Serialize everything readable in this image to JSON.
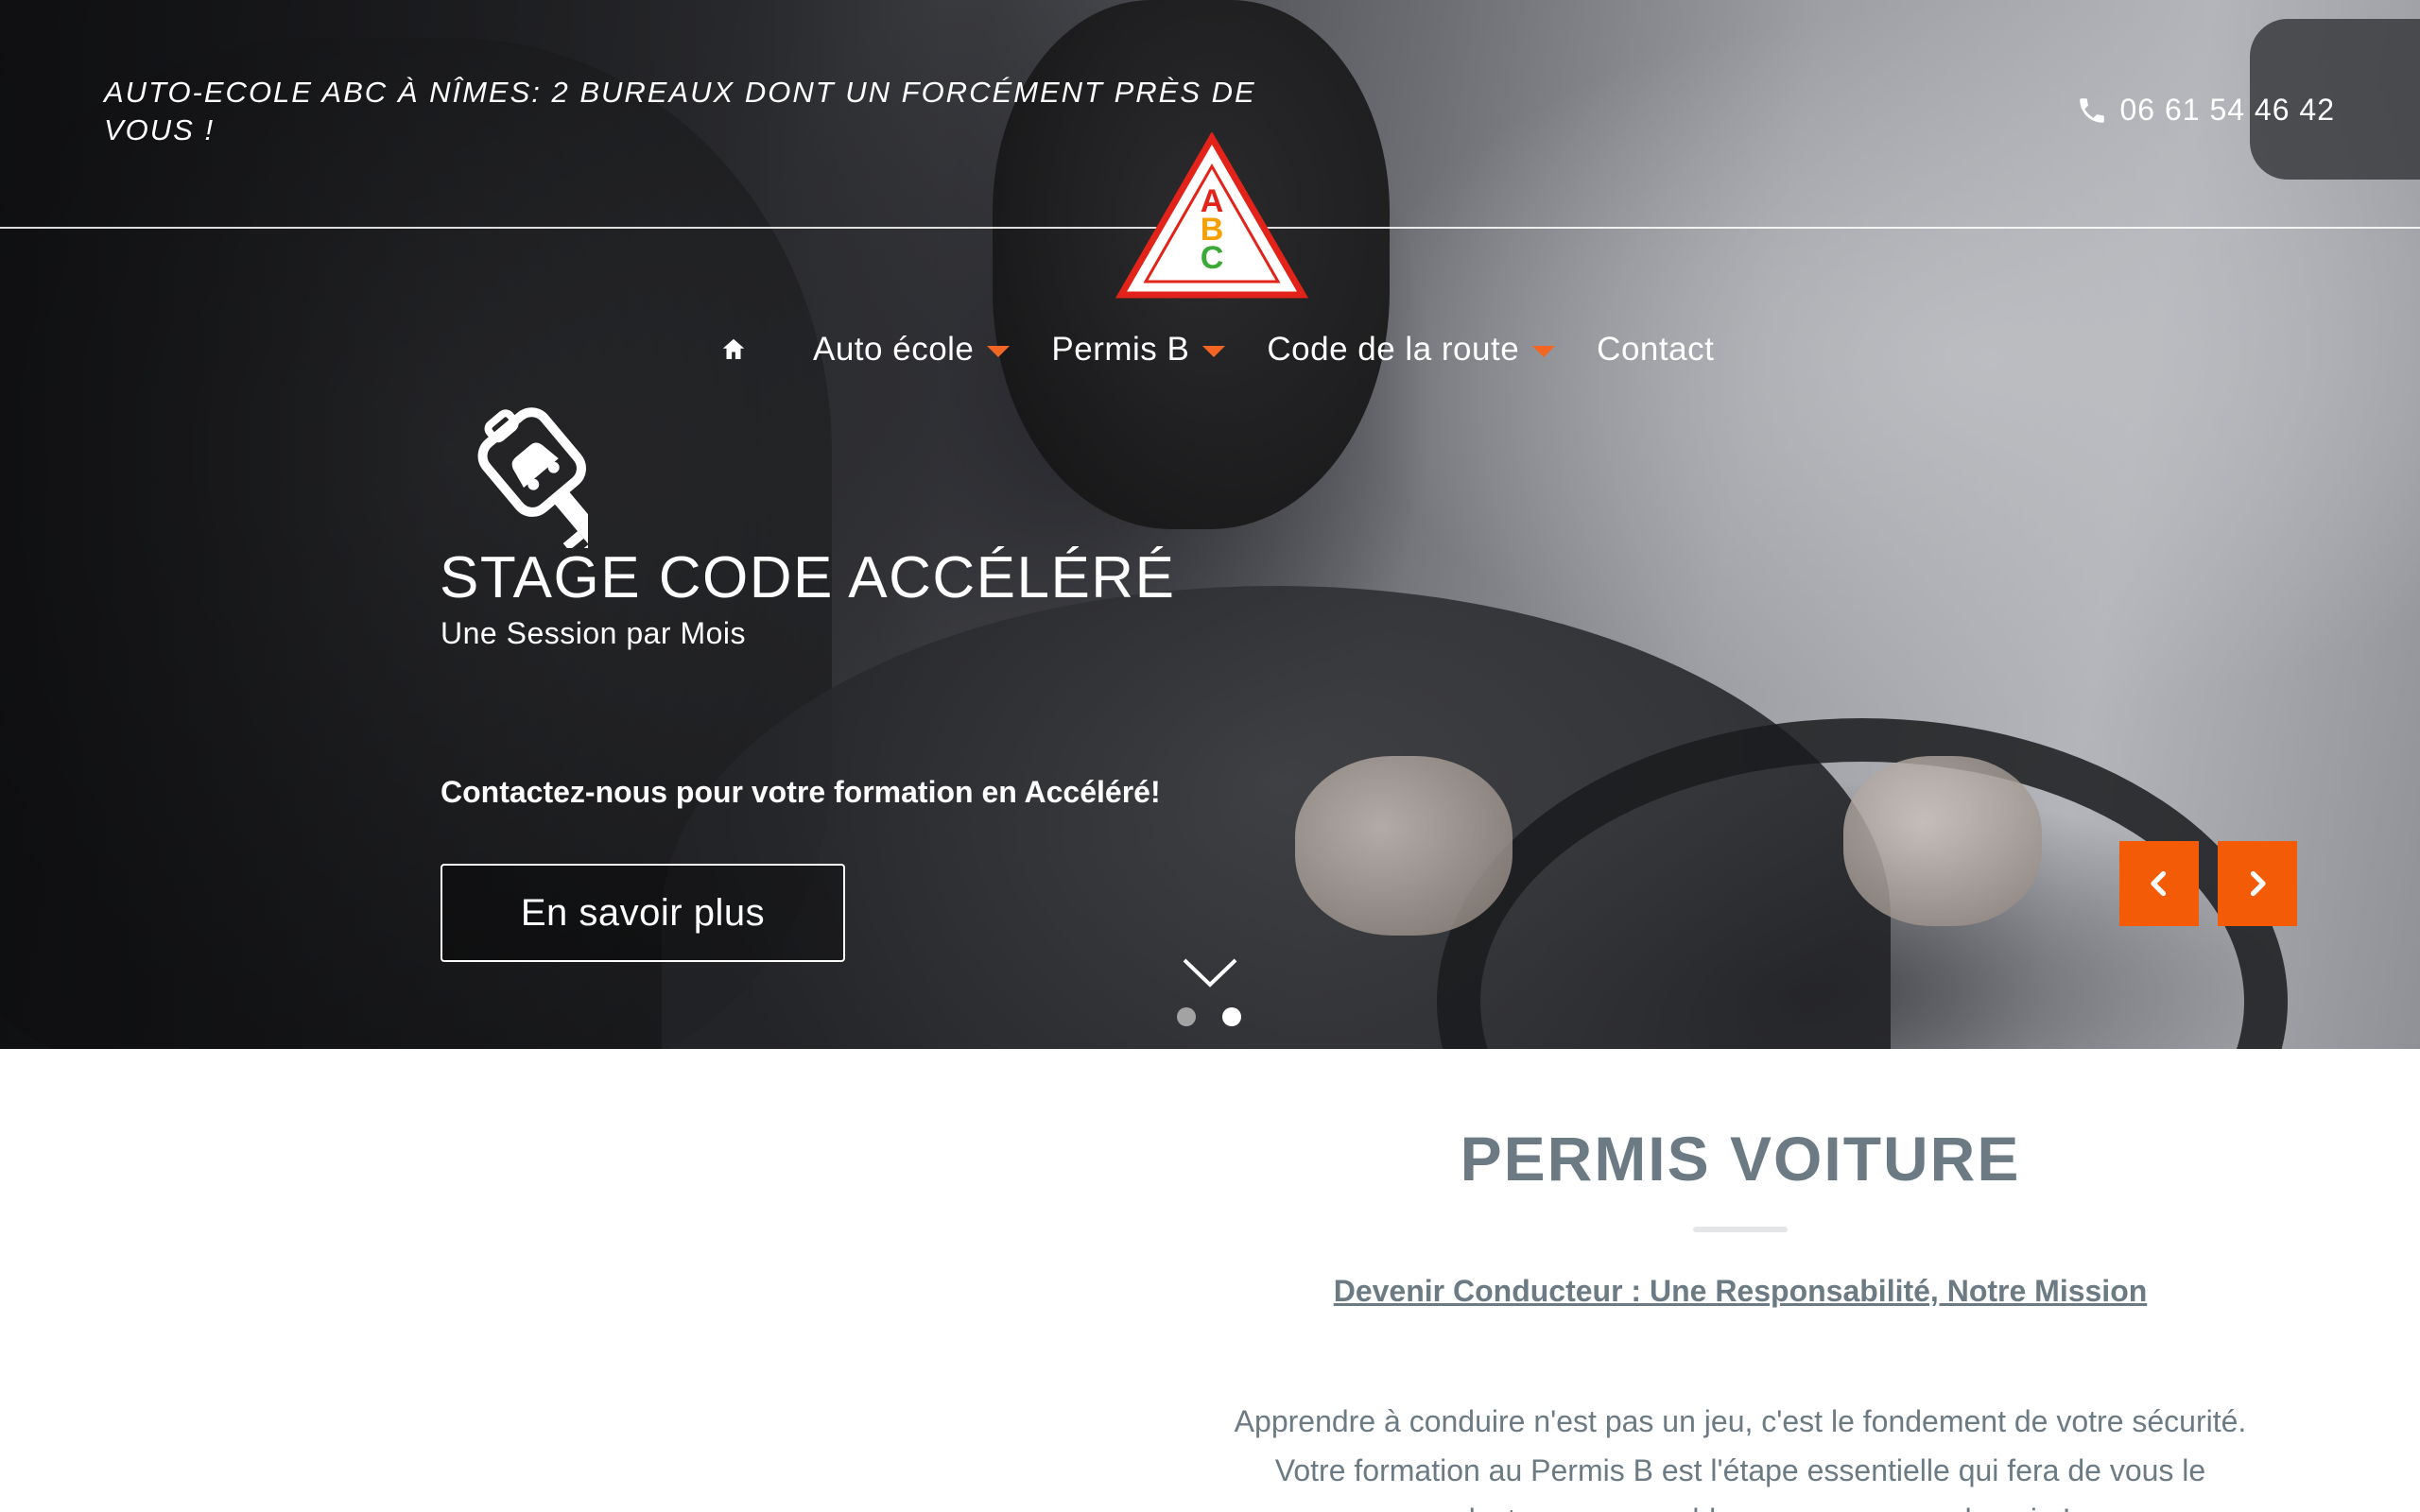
{
  "header": {
    "tagline": "AUTO-ECOLE ABC À NÎMES: 2 BUREAUX DONT UN FORCÉMENT PRÈS DE VOUS !",
    "phone": "06 61 54 46 42",
    "phone_icon": "phone-icon",
    "logo_letters": [
      "A",
      "B",
      "C"
    ],
    "logo_colors": {
      "border": "#e2231a",
      "a": "#e2231a",
      "b": "#f5a000",
      "c": "#3aa935"
    }
  },
  "nav": {
    "home_icon": "home-icon",
    "items": [
      {
        "label": "Auto école",
        "has_dropdown": true
      },
      {
        "label": "Permis B",
        "has_dropdown": true
      },
      {
        "label": "Code de la route",
        "has_dropdown": true
      },
      {
        "label": "Contact",
        "has_dropdown": false
      }
    ],
    "accent": "#f26522"
  },
  "slide": {
    "icon": "car-key-icon",
    "title": "STAGE CODE ACCÉLÉRÉ",
    "subtitle": "Une Session par Mois",
    "cta_text": "Contactez-nous pour votre formation en Accéléré!",
    "button_label": "En savoir plus",
    "prev_icon": "chevron-left-icon",
    "next_icon": "chevron-right-icon",
    "arrow_color": "#f45b06",
    "scroll_icon": "chevron-down-icon",
    "slide_count": 2,
    "active_slide": 2
  },
  "content": {
    "title": "PERMIS VOITURE",
    "link": "Devenir Conducteur : Une Responsabilité, Notre Mission",
    "text_line1": "Apprendre à conduire n'est pas un jeu, c'est le fondement de votre sécurité.",
    "text_line2": "Votre formation au Permis B est l'étape essentielle qui fera de vous le",
    "text_line3": "conducteur responsable que vous serez demain !"
  }
}
